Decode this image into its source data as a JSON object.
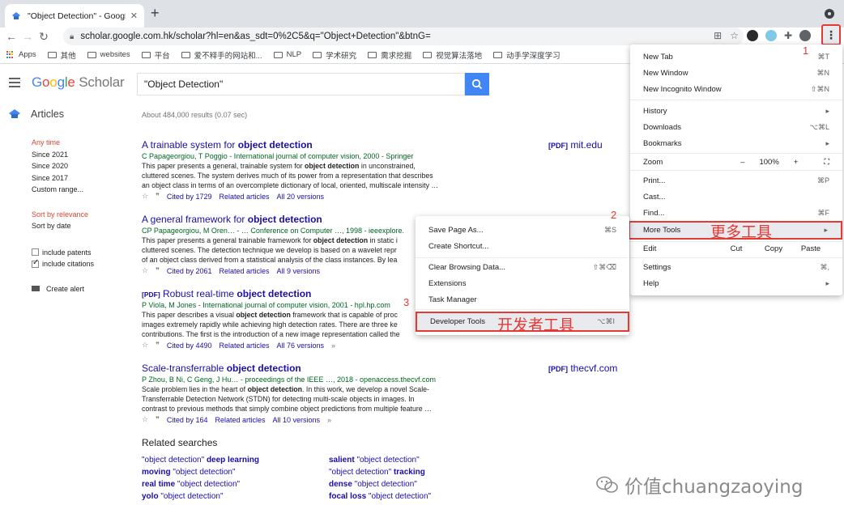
{
  "browser": {
    "tab_title": "\"Object Detection\" - Google S",
    "tab_close": "✕",
    "new_tab": "+",
    "url": "scholar.google.com.hk/scholar?hl=en&as_sdt=0%2C5&q=\"Object+Detection\"&btnG=",
    "menu_glyph": "⋮"
  },
  "bookmarks": [
    {
      "label": "Apps",
      "icon": "apps-grid-icon"
    },
    {
      "label": "其他",
      "icon": "folder-icon"
    },
    {
      "label": "websites",
      "icon": "folder-icon"
    },
    {
      "label": "平台",
      "icon": "folder-icon"
    },
    {
      "label": "爱不释手的网站和...",
      "icon": "folder-icon"
    },
    {
      "label": "NLP",
      "icon": "folder-icon"
    },
    {
      "label": "学术研究",
      "icon": "folder-icon"
    },
    {
      "label": "需求挖掘",
      "icon": "folder-icon"
    },
    {
      "label": "视觉算法落地",
      "icon": "folder-icon"
    },
    {
      "label": "动手学深度学习",
      "icon": "folder-icon"
    }
  ],
  "scholar": {
    "logo_google": "Google",
    "logo_scholar": "Scholar",
    "search_value": "\"Object Detection\"",
    "articles_label": "Articles",
    "results_count": "About 484,000 results (0.07 sec)",
    "time_filters": [
      "Any time",
      "Since 2021",
      "Since 2020",
      "Since 2017",
      "Custom range..."
    ],
    "sort_options": [
      "Sort by relevance",
      "Sort by date"
    ],
    "include_patents": "include patents",
    "include_citations": "include citations",
    "create_alert": "Create alert"
  },
  "results": [
    {
      "pdf_tag": "",
      "title_pre": "A trainable system for ",
      "title_bold": "object detection",
      "authors": "C Papageorgiou, T Poggio - International journal of computer vision, 2000 - Springer",
      "snippet_1": "This paper presents a general, trainable system for ",
      "snippet_1_bold": "object detection",
      "snippet_1_post": " in unconstrained,",
      "snippet_2": "cluttered scenes. The system derives much of its power from a representation that describes",
      "snippet_3": "an object class in terms of an overcomplete dictionary of local, oriented, multiscale intensity …",
      "cited": "Cited by 1729",
      "related": "Related articles",
      "versions": "All 20 versions",
      "side_tag": "[PDF]",
      "side_domain": "mit.edu"
    },
    {
      "pdf_tag": "",
      "title_pre": "A general framework for ",
      "title_bold": "object detection",
      "authors": "CP Papageorgiou, M Oren… - … Conference on Computer …, 1998 - ieeexplore.",
      "snippet_1": "This paper presents a general trainable framework for ",
      "snippet_1_bold": "object detection",
      "snippet_1_post": " in static i",
      "snippet_2": "cluttered scenes. The detection technique we develop is based on a wavelet repr",
      "snippet_3": "of an object class derived from a statistical analysis of the class instances. By lea",
      "cited": "Cited by 2061",
      "related": "Related articles",
      "versions": "All 9 versions",
      "side_tag": "",
      "side_domain": ""
    },
    {
      "pdf_tag": "[PDF]",
      "title_pre": " Robust real-time ",
      "title_bold": "object detection",
      "authors": "P Viola, M Jones - International journal of computer vision, 2001 - hpl.hp.com",
      "snippet_1": "This paper describes a visual ",
      "snippet_1_bold": "object detection",
      "snippet_1_post": " framework that is capable of proc",
      "snippet_2": "images extremely rapidly while achieving high detection rates. There are three ke",
      "snippet_3": "contributions. The first is the introduction of a new image representation called the",
      "cited": "Cited by 4490",
      "related": "Related articles",
      "versions": "All 76 versions",
      "side_tag": "",
      "side_domain": ""
    },
    {
      "pdf_tag": "",
      "title_pre": "Scale-transferrable ",
      "title_bold": "object detection",
      "authors": "P Zhou, B Ni, C Geng, J Hu… - proceedings of the IEEE …, 2018 - openaccess.thecvf.com",
      "snippet_1": "Scale problem lies in the heart of ",
      "snippet_1_bold": "object detection",
      "snippet_1_post": ". In this work, we develop a novel Scale-",
      "snippet_2": "Transferrable Detection Network (STDN) for detecting multi-scale objects in images. In",
      "snippet_3": "contrast to previous methods that simply combine object predictions from multiple feature …",
      "cited": "Cited by 164",
      "related": "Related articles",
      "versions": "All 10 versions",
      "side_tag": "[PDF]",
      "side_domain": "thecvf.com"
    }
  ],
  "related_searches": {
    "title": "Related searches",
    "items": [
      {
        "pre": "\"object detection\" ",
        "bold": "deep learning",
        "post": ""
      },
      {
        "pre": "",
        "bold": "salient",
        "post": " \"object detection\""
      },
      {
        "pre": "",
        "bold": "moving",
        "post": " \"object detection\""
      },
      {
        "pre": "\"object detection\" ",
        "bold": "tracking",
        "post": ""
      },
      {
        "pre": "",
        "bold": "real time",
        "post": " \"object detection\""
      },
      {
        "pre": "",
        "bold": "dense",
        "post": " \"object detection\""
      },
      {
        "pre": "",
        "bold": "yolo",
        "post": " \"object detection\""
      },
      {
        "pre": "",
        "bold": "focal loss",
        "post": " \"object detection\""
      }
    ]
  },
  "chrome_menu": {
    "new_tab": "New Tab",
    "new_tab_sc": "⌘T",
    "new_window": "New Window",
    "new_window_sc": "⌘N",
    "incognito": "New Incognito Window",
    "incognito_sc": "⇧⌘N",
    "history": "History",
    "downloads": "Downloads",
    "downloads_sc": "⌥⌘L",
    "bookmarks": "Bookmarks",
    "zoom": "Zoom",
    "zoom_minus": "–",
    "zoom_value": "100%",
    "zoom_plus": "+",
    "print": "Print...",
    "print_sc": "⌘P",
    "cast": "Cast...",
    "find": "Find...",
    "find_sc": "⌘F",
    "more_tools": "More Tools",
    "edit": "Edit",
    "cut": "Cut",
    "copy": "Copy",
    "paste": "Paste",
    "settings": "Settings",
    "settings_sc": "⌘,",
    "help": "Help",
    "arrow": "▸"
  },
  "more_tools_menu": {
    "save_page": "Save Page As...",
    "save_page_sc": "⌘S",
    "create_shortcut": "Create Shortcut...",
    "clear_browsing": "Clear Browsing Data...",
    "clear_browsing_sc": "⇧⌘⌫",
    "extensions": "Extensions",
    "task_manager": "Task Manager",
    "developer_tools": "Developer Tools",
    "developer_tools_sc": "⌥⌘I"
  },
  "annotations": {
    "step1": "1",
    "step2": "2",
    "step3": "3",
    "more_tools_cn": "更多工具",
    "dev_tools_cn": "开发者工具"
  },
  "watermark": "价值chuangzaoying",
  "colors": {
    "google_blue": "#4285f4",
    "google_red": "#ea4335",
    "google_yellow": "#fbbc05",
    "google_green": "#34a853",
    "annotation_red": "#e53935",
    "link_blue": "#1a0dab",
    "author_green": "#006621"
  }
}
